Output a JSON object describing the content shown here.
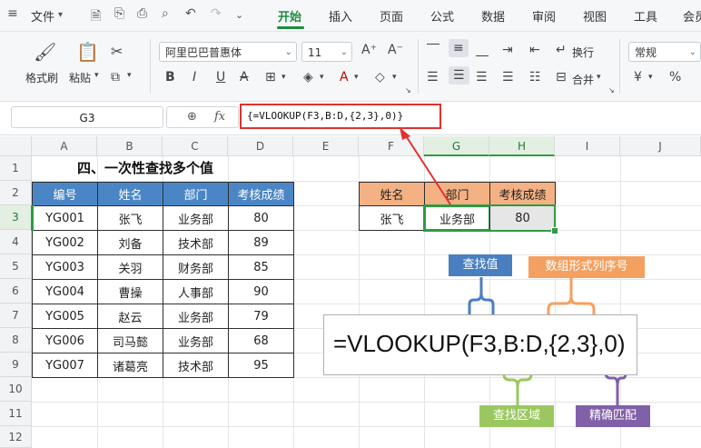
{
  "menu": {
    "file_label": "文件",
    "tabs": [
      "开始",
      "插入",
      "页面",
      "公式",
      "数据",
      "审阅",
      "视图",
      "工具",
      "会员"
    ],
    "active_tab": "开始"
  },
  "ribbon": {
    "format_painter": "格式刷",
    "paste": "粘贴",
    "font_name": "阿里巴巴普惠体",
    "font_size": "11",
    "bold": "B",
    "italic": "I",
    "underline": "U",
    "strike": "A",
    "grow_font": "A⁺",
    "shrink_font": "A⁻",
    "wrap_text": "换行",
    "merge": "合并",
    "number_format": "常规",
    "currency": "¥",
    "percent": "%"
  },
  "formula_bar": {
    "name_box": "G3",
    "fx": "fx",
    "formula": "{=VLOOKUP(F3,B:D,{2,3},0)}"
  },
  "grid": {
    "columns": [
      "A",
      "B",
      "C",
      "D",
      "E",
      "F",
      "G",
      "H",
      "I",
      "J"
    ],
    "rows": [
      "1",
      "2",
      "3",
      "4",
      "5",
      "6",
      "7",
      "8",
      "9",
      "10",
      "11",
      "12"
    ],
    "title": "四、一次性查找多个值"
  },
  "main_table": {
    "headers": [
      "编号",
      "姓名",
      "部门",
      "考核成绩"
    ],
    "rows": [
      [
        "YG001",
        "张飞",
        "业务部",
        "80"
      ],
      [
        "YG002",
        "刘备",
        "技术部",
        "89"
      ],
      [
        "YG003",
        "关羽",
        "财务部",
        "85"
      ],
      [
        "YG004",
        "曹操",
        "人事部",
        "90"
      ],
      [
        "YG005",
        "赵云",
        "业务部",
        "79"
      ],
      [
        "YG006",
        "司马懿",
        "业务部",
        "68"
      ],
      [
        "YG007",
        "诸葛亮",
        "技术部",
        "95"
      ]
    ]
  },
  "lookup_table": {
    "headers": [
      "姓名",
      "部门",
      "考核成绩"
    ],
    "row": [
      "张飞",
      "业务部",
      "80"
    ]
  },
  "diagram": {
    "formula": "=VLOOKUP(F3,B:D,{2,3},0)",
    "labels": {
      "lookup_value": "查找值",
      "array_col": "数组形式列序号",
      "range": "查找区域",
      "exact": "精确匹配"
    },
    "colors": {
      "lookup_value": "#4a7fbf",
      "array_col": "#f4a060",
      "range": "#9bc760",
      "exact": "#8060a8",
      "highlight": "#e0322e",
      "header_blue": "#4a86c5",
      "header_orange": "#f4b183",
      "accent_green": "#1e8e3e"
    }
  }
}
